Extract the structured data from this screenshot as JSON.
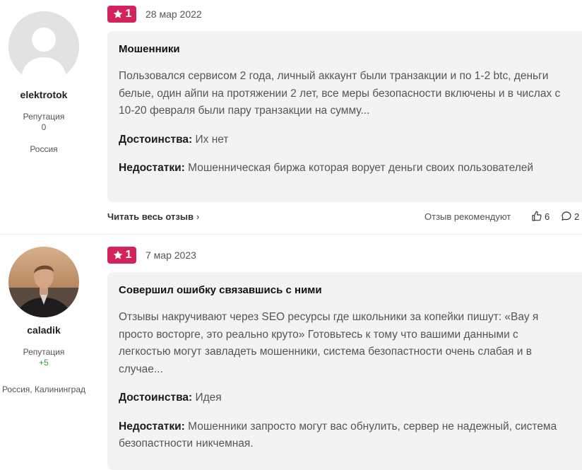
{
  "reviews": [
    {
      "user": "elektrotok",
      "rep_label": "Репутация",
      "rep_value": "0",
      "location": "Россия",
      "rating": "1",
      "date": "28 мар 2022",
      "title": "Мошенники",
      "text": "Пользовался сервисом 2 года, личный аккаунт были транзакции и по 1-2 btc, деньги белые, один айпи на протяжении 2 лет, все меры безопасности включены и в числах с 10-20 февраля были пару транзакции на сумму...",
      "pros_label": "Достоинства:",
      "pros": "Их нет",
      "cons_label": "Недостатки:",
      "cons": "Мошенническая биржа которая ворует деньги своих пользователей",
      "read_more": "Читать весь отзыв",
      "recommend": "Отзыв рекомендуют",
      "likes": "6",
      "comments": "2"
    },
    {
      "user": "caladik",
      "rep_label": "Репутация",
      "rep_value": "+5",
      "location": "Россия, Калининград",
      "rating": "1",
      "date": "7 мар 2023",
      "title": "Совершил ошибку связавшись с ними",
      "text": "Отзывы накручивают через SEO ресурсы где школьники за копейки пишут: «Вау я просто восторге, это реально круто» Готовьтесь к тому что вашими данными с легкостью могут завладеть мошенники, система безопастности очень слабая и в случае...",
      "pros_label": "Достоинства:",
      "pros": "Идея",
      "cons_label": "Недостатки:",
      "cons": "Мошенники запросто могут вас обнулить, сервер не надежный, система безопастности никчемная."
    }
  ],
  "colors": {
    "badge": "#d3235a",
    "card": "#f3f3f4",
    "positive": "#2f9e3a"
  },
  "icons": [
    "star-icon",
    "thumbs-up-icon",
    "comment-icon",
    "chevron-right-icon"
  ]
}
